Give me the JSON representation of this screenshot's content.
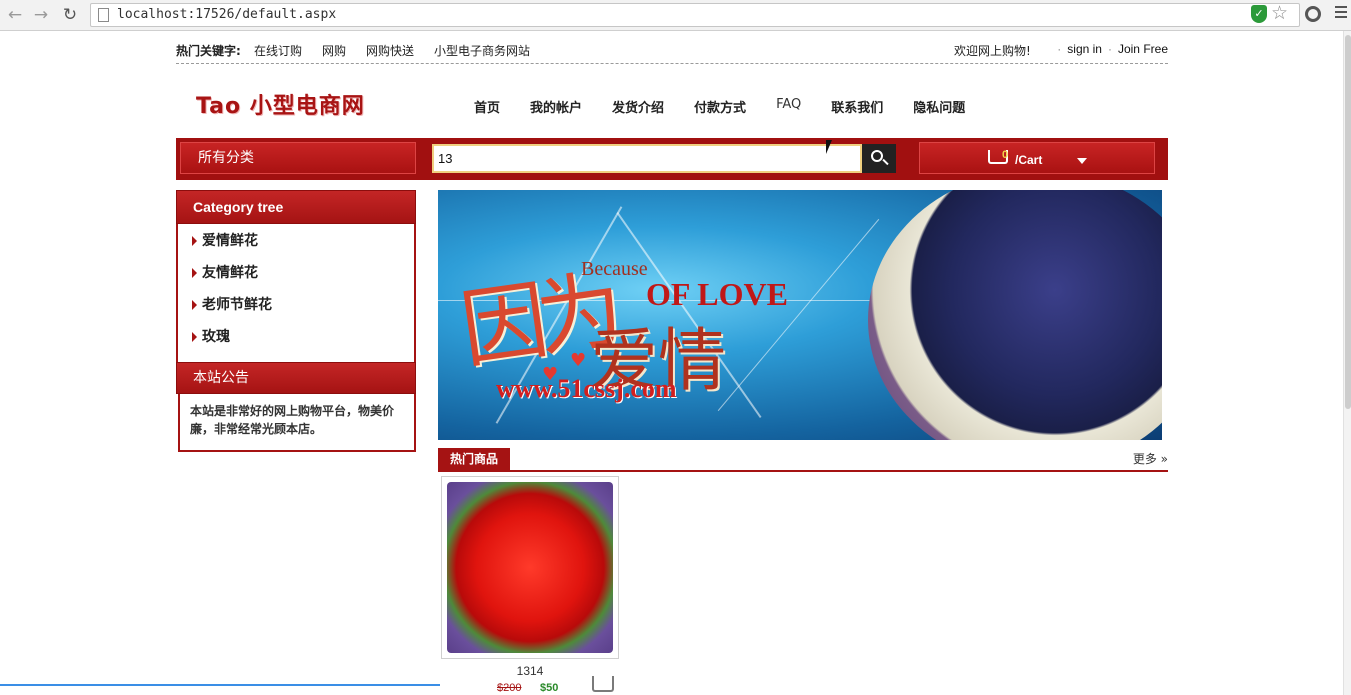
{
  "browser": {
    "url": "localhost:17526/default.aspx"
  },
  "topbar": {
    "hot_label": "热门关键字:",
    "hot_links": [
      "在线订购",
      "网购",
      "网购快送",
      "小型电子商务网站"
    ],
    "welcome": "欢迎网上购物!",
    "sign_in": "sign in",
    "join_free": "Join Free"
  },
  "logo": "Tao 小型电商网",
  "nav": [
    "首页",
    "我的帐户",
    "发货介绍",
    "付款方式",
    "FAQ",
    "联系我们",
    "隐私问题"
  ],
  "search": {
    "category_button": "所有分类",
    "value": "13"
  },
  "cart": {
    "count": "0",
    "label": "/Cart"
  },
  "sidebar": {
    "category_title": "Category tree",
    "categories": [
      "爱情鲜花",
      "友情鲜花",
      "老师节鲜花",
      "玫瑰"
    ],
    "notice_title": "本站公告",
    "notice_text": "本站是非常好的网上购物平台，物美价廉，非常经常光顾本店。"
  },
  "banner": {
    "cn_title_1": "因为",
    "en_title_1": "Because",
    "en_title_2": "OF LOVE",
    "cn_title_2": "爱情",
    "site": "www.51cssj.com"
  },
  "hot_products": {
    "tab": "热门商品",
    "more": "更多 »",
    "items": [
      {
        "name": "1314",
        "price_old": "$200",
        "price_new": "$50"
      }
    ]
  },
  "colors": {
    "brand_red": "#a51313",
    "price_green": "#2a8a2a",
    "cart_count": "#f2d34a"
  }
}
